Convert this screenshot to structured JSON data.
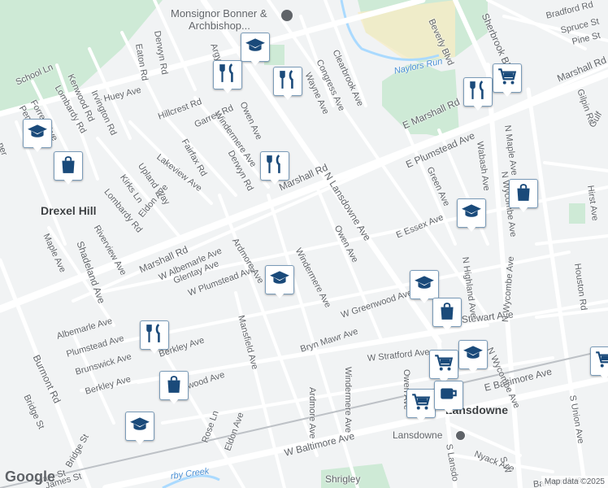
{
  "map": {
    "labels": {
      "monsignor": "Monsignor Bonner &",
      "archbishop": "Archbishop...",
      "drexel_hill": "Drexel Hill",
      "lansdowne_town": "Lansdowne",
      "lansdowne_station": "Lansdowne",
      "shrigley": "Shrigley",
      "naylors_run": "Naylors Run",
      "darby_creek": "rby Creek"
    },
    "streets": {
      "school_ln": "School Ln",
      "forrest_ave": "Forrest Ave",
      "lombardy_rd_1": "Lombardy Rd",
      "kenwood_rd": "Kenwood Rd",
      "irvington_rd": "Irvington Rd",
      "eaton_rd": "Eaton Rd",
      "derwyn_rd_1": "Derwyn Rd",
      "huey_ave": "Huey Ave",
      "hillcrest_rd": "Hillcrest Rd",
      "garrett_rd": "Garrett Rd",
      "owen_ave_1": "Owen Ave",
      "windermere_ave_1": "Windermere Ave",
      "derwyn_rd_2": "Derwyn Rd",
      "fairfax_rd": "Fairfax Rd",
      "lakeview_ave": "Lakeview Ave",
      "upland_way": "Upland Way",
      "kirks_ln": "Kirks Ln",
      "lombardy_rd_2": "Lombardy Rd",
      "eldon_ave_1": "Eldon Ave",
      "riverview_ave": "Riverview Ave",
      "maple_ave": "Maple Ave",
      "shadeland_ave": "Shadeland Ave",
      "marshall_rd_1": "Marshall Rd",
      "marshall_rd_2": "Marshall Rd",
      "w_albemarle_ave": "W Albemarle Ave",
      "glentay_ave": "Glentay Ave",
      "w_plumstead_ave": "W Plumstead Ave",
      "ardmore_ave_1": "Ardmore Ave",
      "ardmore_ave_2": "Ardmore Ave",
      "windermere_ave_2": "Windermere Ave",
      "windermere_ave_3": "Windermere Ave",
      "owen_ave_2": "Owen Ave",
      "owen_ave_3": "Owen Ave",
      "n_lansdowne_ave": "N Lansdowne Ave",
      "e_essex_ave": "E Essex Ave",
      "w_greenwood_ave": "W Greenwood Ave",
      "greenwood_ave": "reenwood Ave",
      "mansfield_ave": "Mansfield Ave",
      "bryn_mawr_ave": "Bryn Mawr Ave",
      "albemarle_ave": "Albemarle Ave",
      "plumstead_ave": "Plumstead Ave",
      "brunswick_ave": "Brunswick Ave",
      "berkley_ave_1": "Berkley Ave",
      "berkley_ave_2": "Berkley Ave",
      "burmont_rd": "Burmont Rd",
      "bridge_st_1": "Bridge St",
      "bridge_st_2": "Bridge St",
      "mary_st": "Mary St",
      "james_st": "James St",
      "rose_ln": "Rose Ln",
      "eldon_ave_2": "Eldon Ave",
      "w_baltimore_ave": "W Baltimore Ave",
      "e_baltimore_ave": "E Baltimore Ave",
      "w_stratford_ave": "W Stratford Ave",
      "stewart_ave": "Stewart Ave",
      "s_lansdowne": "S Lansdo",
      "nyack_ave": "Nyack Ave",
      "bartram_ave": "Bartram Ave",
      "s_union_ave": "S Union Ave",
      "s_w": "S W",
      "n_wycombe_ave_1": "N Wycombe Ave",
      "n_wycombe_ave_2": "N Wycombe Ave",
      "n_wycombe_ave_3": "N Wycombe Ave",
      "n_highland_ave": "N Highland Ave",
      "n_maple_ave": "N Maple Ave",
      "wabash_ave": "Wabash Ave",
      "green_ave": "Green Ave",
      "houston_rd": "Houston Rd",
      "hirst_ave": "Hirst Ave",
      "gilpin_rd": "Gilpin Rd",
      "marshall_rd_e": "Marshall Rd",
      "e_marshall_rd": "E Marshall Rd",
      "e_plumstead_ave": "E Plumstead Ave",
      "sherbrook_blvd": "Sherbrook Blvd",
      "beverly_blvd": "Beverly Blvd",
      "bradford_rd": "Bradford Rd",
      "spruce_st": "Spruce St",
      "pine_st": "Pine St",
      "clearbrook_ave": "Clearbrook Ave",
      "congress_ave": "Congress Ave",
      "wayne_ave": "Wayne Ave",
      "argyle": "Argy",
      "gulf": "Gulf",
      "pen": "Pen",
      "per": "per"
    },
    "markers": [
      {
        "icon": "school",
        "interactable": true
      },
      {
        "icon": "restaurant",
        "interactable": true
      },
      {
        "icon": "restaurant",
        "interactable": true
      },
      {
        "icon": "school",
        "interactable": true
      },
      {
        "icon": "shopping-bag",
        "interactable": true
      },
      {
        "icon": "restaurant",
        "interactable": true
      },
      {
        "icon": "cart",
        "interactable": true
      },
      {
        "icon": "restaurant",
        "interactable": true
      },
      {
        "icon": "shopping-bag",
        "interactable": true
      },
      {
        "icon": "school",
        "interactable": true
      },
      {
        "icon": "school",
        "interactable": true
      },
      {
        "icon": "school",
        "interactable": true
      },
      {
        "icon": "shopping-bag",
        "interactable": true
      },
      {
        "icon": "restaurant",
        "interactable": true
      },
      {
        "icon": "shopping-bag",
        "interactable": true
      },
      {
        "icon": "school",
        "interactable": true
      },
      {
        "icon": "school",
        "interactable": true
      },
      {
        "icon": "cart",
        "interactable": true
      },
      {
        "icon": "cart",
        "interactable": true
      },
      {
        "icon": "cafe",
        "interactable": true
      },
      {
        "icon": "cart",
        "interactable": true
      }
    ],
    "colors": {
      "background": "#f1f3f4",
      "road": "#ffffff",
      "park": "#ceead6",
      "water": "#aadaff",
      "marker_icon": "#1a4a7a",
      "marker_border": "#7a9bb8"
    }
  },
  "footer": {
    "google_logo": "Google",
    "map_data": "Map data ©2025"
  }
}
